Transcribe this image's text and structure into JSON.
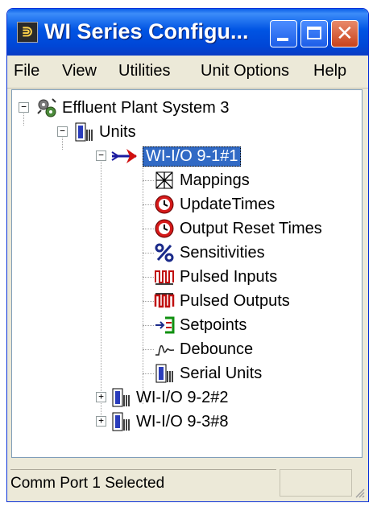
{
  "window": {
    "title": "WI Series Configu...",
    "app_icon_glyph": "⋑",
    "colors": {
      "titlebar": "#0054e3",
      "selection": "#316ac5",
      "close_button": "#c8421c"
    }
  },
  "menu": [
    "File",
    "View",
    "Utilities",
    "Unit Options",
    "Help"
  ],
  "tree": {
    "root": {
      "label": "Effluent Plant System 3",
      "icon": "gears-icon",
      "expanded": true
    },
    "units": {
      "label": "Units",
      "icon": "unit-device-icon",
      "expanded": true
    },
    "selected_unit": {
      "label": "WI-I/O 9-1#1",
      "icon": "arrow-pointer-icon",
      "expanded": true
    },
    "children": [
      {
        "label": "Mappings",
        "icon": "mappings-icon"
      },
      {
        "label": "UpdateTimes",
        "icon": "clock-icon"
      },
      {
        "label": "Output Reset Times",
        "icon": "clock-icon"
      },
      {
        "label": "Sensitivities",
        "icon": "percent-icon"
      },
      {
        "label": "Pulsed Inputs",
        "icon": "pulse-icon"
      },
      {
        "label": "Pulsed Outputs",
        "icon": "pulse-red-icon"
      },
      {
        "label": "Setpoints",
        "icon": "setpoints-icon"
      },
      {
        "label": "Debounce",
        "icon": "wave-icon"
      },
      {
        "label": "Serial Units",
        "icon": "unit-device-icon"
      }
    ],
    "other_units": [
      {
        "label": "WI-I/O 9-2#2",
        "icon": "unit-device-icon",
        "expanded": false
      },
      {
        "label": "WI-I/O 9-3#8",
        "icon": "unit-device-icon",
        "expanded": false
      }
    ]
  },
  "status": {
    "text": "Comm Port 1 Selected"
  }
}
